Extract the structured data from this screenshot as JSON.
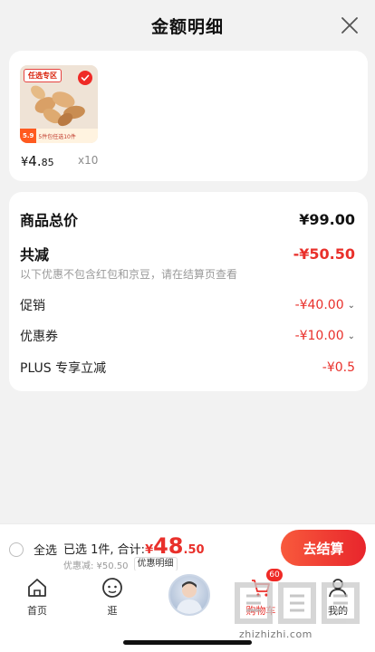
{
  "header": {
    "title": "金额明细"
  },
  "product": {
    "tag": "任选专区",
    "thumb_price": "5.9",
    "thumb_strip_text": "5件包任选10件",
    "price_yen": "¥",
    "price_int": "4.",
    "price_dec": "85",
    "quantity": "x10"
  },
  "breakdown": {
    "total_label": "商品总价",
    "total_value": "¥99.00",
    "reduce_label": "共减",
    "reduce_value": "-¥50.50",
    "note": "以下优惠不包含红包和京豆，请在结算页查看",
    "items": [
      {
        "label": "促销",
        "value": "-¥40.00"
      },
      {
        "label": "优惠券",
        "value": "-¥10.00"
      },
      {
        "label": "PLUS 专享立减",
        "value": "-¥0.5"
      }
    ]
  },
  "checkout": {
    "select_all": "全选",
    "summary_prefix": "已选 1件, 合计:",
    "amount_yen": "¥",
    "amount_int": "48",
    "amount_dec": ".50",
    "discount_sum": "优惠减: ¥50.50",
    "detail_link": "优惠明细",
    "checkout_button": "去结算"
  },
  "tabbar": {
    "home": "首页",
    "browse": "逛",
    "cart_badge": "60",
    "cart": "购物车",
    "me": "我的"
  },
  "watermark": "zhizhizhi.com",
  "colors": {
    "accent_red": "#e9302b",
    "button_gradient_start": "#f85a3c",
    "button_gradient_end": "#e8252c",
    "background": "#f2f2f2"
  }
}
